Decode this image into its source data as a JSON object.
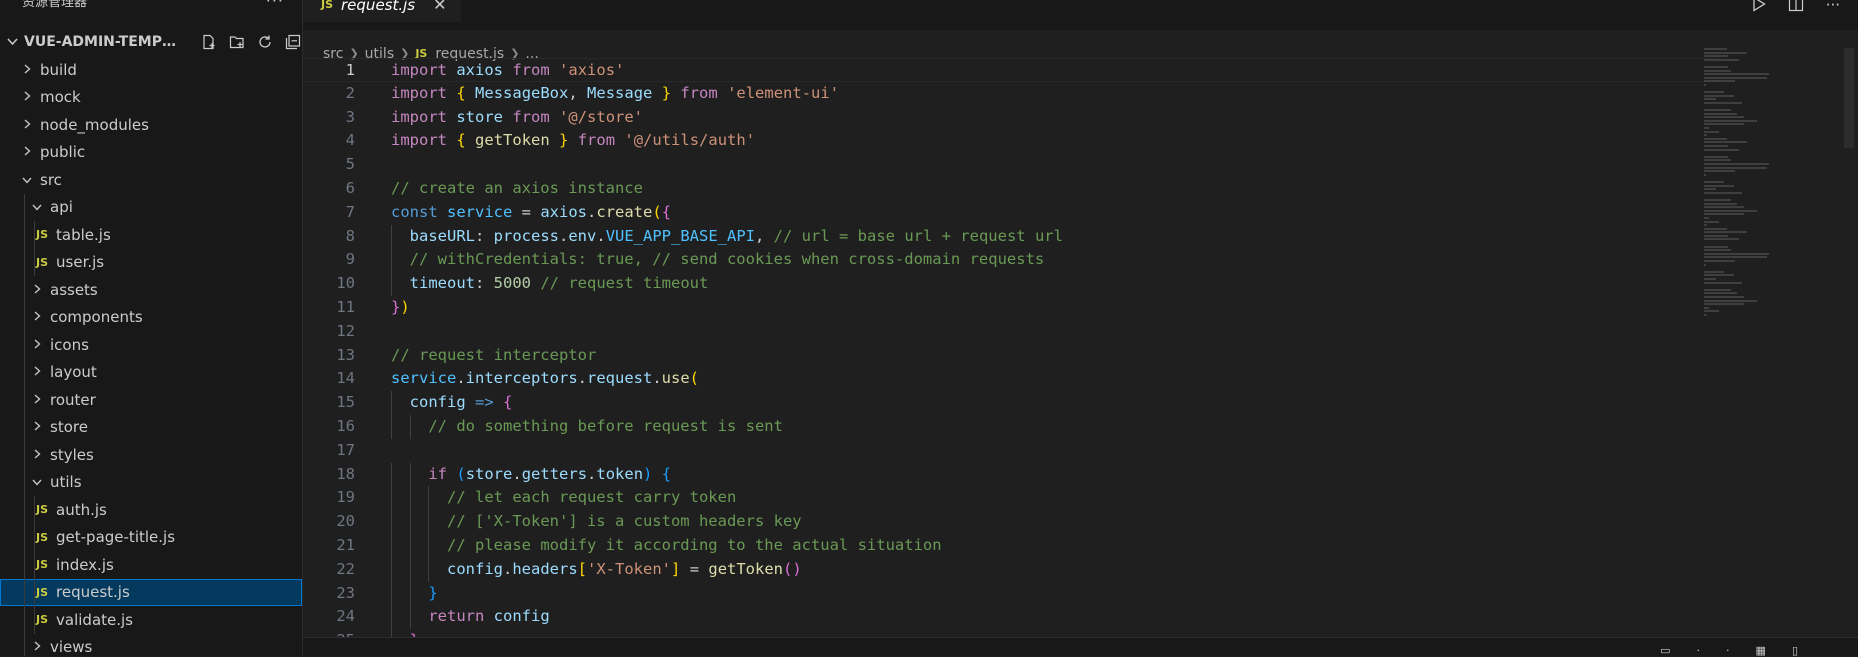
{
  "sidebar": {
    "header_title": "资源管理器",
    "more": "···",
    "project_title": "VUE-ADMIN-TEMPLAT...",
    "tree": [
      {
        "label": "build",
        "type": "folder",
        "depth": 0,
        "open": false
      },
      {
        "label": "mock",
        "type": "folder",
        "depth": 0,
        "open": false
      },
      {
        "label": "node_modules",
        "type": "folder",
        "depth": 0,
        "open": false
      },
      {
        "label": "public",
        "type": "folder",
        "depth": 0,
        "open": false
      },
      {
        "label": "src",
        "type": "folder",
        "depth": 0,
        "open": true
      },
      {
        "label": "api",
        "type": "folder",
        "depth": 1,
        "open": true
      },
      {
        "label": "table.js",
        "type": "file",
        "depth": 2
      },
      {
        "label": "user.js",
        "type": "file",
        "depth": 2
      },
      {
        "label": "assets",
        "type": "folder",
        "depth": 1,
        "open": false
      },
      {
        "label": "components",
        "type": "folder",
        "depth": 1,
        "open": false
      },
      {
        "label": "icons",
        "type": "folder",
        "depth": 1,
        "open": false
      },
      {
        "label": "layout",
        "type": "folder",
        "depth": 1,
        "open": false
      },
      {
        "label": "router",
        "type": "folder",
        "depth": 1,
        "open": false
      },
      {
        "label": "store",
        "type": "folder",
        "depth": 1,
        "open": false
      },
      {
        "label": "styles",
        "type": "folder",
        "depth": 1,
        "open": false
      },
      {
        "label": "utils",
        "type": "folder",
        "depth": 1,
        "open": true
      },
      {
        "label": "auth.js",
        "type": "file",
        "depth": 2
      },
      {
        "label": "get-page-title.js",
        "type": "file",
        "depth": 2
      },
      {
        "label": "index.js",
        "type": "file",
        "depth": 2
      },
      {
        "label": "request.js",
        "type": "file",
        "depth": 2,
        "selected": true
      },
      {
        "label": "validate.js",
        "type": "file",
        "depth": 2
      },
      {
        "label": "views",
        "type": "folder",
        "depth": 1,
        "open": false
      }
    ]
  },
  "editor": {
    "tab_label": "request.js",
    "file_badge": "JS",
    "breadcrumb": [
      "src",
      "utils",
      "request.js",
      "..."
    ],
    "active_line": 1,
    "lines": [
      [
        [
          "kw",
          "import"
        ],
        [
          "pl",
          " "
        ],
        [
          "var",
          "axios"
        ],
        [
          "pl",
          " "
        ],
        [
          "kw",
          "from"
        ],
        [
          "pl",
          " "
        ],
        [
          "str",
          "'axios'"
        ]
      ],
      [
        [
          "kw",
          "import"
        ],
        [
          "pl",
          " "
        ],
        [
          "b1",
          "{"
        ],
        [
          "pl",
          " "
        ],
        [
          "var",
          "MessageBox"
        ],
        [
          "pl",
          ", "
        ],
        [
          "var",
          "Message"
        ],
        [
          "pl",
          " "
        ],
        [
          "b1",
          "}"
        ],
        [
          "pl",
          " "
        ],
        [
          "kw",
          "from"
        ],
        [
          "pl",
          " "
        ],
        [
          "str",
          "'element-ui'"
        ]
      ],
      [
        [
          "kw",
          "import"
        ],
        [
          "pl",
          " "
        ],
        [
          "var",
          "store"
        ],
        [
          "pl",
          " "
        ],
        [
          "kw",
          "from"
        ],
        [
          "pl",
          " "
        ],
        [
          "str",
          "'@/store'"
        ]
      ],
      [
        [
          "kw",
          "import"
        ],
        [
          "pl",
          " "
        ],
        [
          "b1",
          "{"
        ],
        [
          "pl",
          " "
        ],
        [
          "fn",
          "getToken"
        ],
        [
          "pl",
          " "
        ],
        [
          "b1",
          "}"
        ],
        [
          "pl",
          " "
        ],
        [
          "kw",
          "from"
        ],
        [
          "pl",
          " "
        ],
        [
          "str",
          "'@/utils/auth'"
        ]
      ],
      [],
      [
        [
          "cm",
          "// create an axios instance"
        ]
      ],
      [
        [
          "dec",
          "const"
        ],
        [
          "pl",
          " "
        ],
        [
          "cst",
          "service"
        ],
        [
          "pl",
          " = "
        ],
        [
          "var",
          "axios"
        ],
        [
          "pl",
          "."
        ],
        [
          "fn",
          "create"
        ],
        [
          "b1",
          "("
        ],
        [
          "b2",
          "{"
        ]
      ],
      [
        [
          "pl",
          "  "
        ],
        [
          "var",
          "baseURL"
        ],
        [
          "pl",
          ": "
        ],
        [
          "var",
          "process"
        ],
        [
          "pl",
          "."
        ],
        [
          "var",
          "env"
        ],
        [
          "pl",
          "."
        ],
        [
          "cst",
          "VUE_APP_BASE_API"
        ],
        [
          "pl",
          ", "
        ],
        [
          "cm",
          "// url = base url + request url"
        ]
      ],
      [
        [
          "pl",
          "  "
        ],
        [
          "cm",
          "// withCredentials: true, // send cookies when cross-domain requests"
        ]
      ],
      [
        [
          "pl",
          "  "
        ],
        [
          "var",
          "timeout"
        ],
        [
          "pl",
          ": "
        ],
        [
          "num",
          "5000"
        ],
        [
          "pl",
          " "
        ],
        [
          "cm",
          "// request timeout"
        ]
      ],
      [
        [
          "b2",
          "}"
        ],
        [
          "b1",
          ")"
        ]
      ],
      [],
      [
        [
          "cm",
          "// request interceptor"
        ]
      ],
      [
        [
          "cst",
          "service"
        ],
        [
          "pl",
          "."
        ],
        [
          "var",
          "interceptors"
        ],
        [
          "pl",
          "."
        ],
        [
          "var",
          "request"
        ],
        [
          "pl",
          "."
        ],
        [
          "fn",
          "use"
        ],
        [
          "b1",
          "("
        ]
      ],
      [
        [
          "pl",
          "  "
        ],
        [
          "var",
          "config"
        ],
        [
          "pl",
          " "
        ],
        [
          "dec",
          "=>"
        ],
        [
          "pl",
          " "
        ],
        [
          "b2",
          "{"
        ]
      ],
      [
        [
          "pl",
          "    "
        ],
        [
          "cm",
          "// do something before request is sent"
        ]
      ],
      [],
      [
        [
          "pl",
          "    "
        ],
        [
          "kw",
          "if"
        ],
        [
          "pl",
          " "
        ],
        [
          "b3",
          "("
        ],
        [
          "var",
          "store"
        ],
        [
          "pl",
          "."
        ],
        [
          "var",
          "getters"
        ],
        [
          "pl",
          "."
        ],
        [
          "var",
          "token"
        ],
        [
          "b3",
          ")"
        ],
        [
          "pl",
          " "
        ],
        [
          "b3",
          "{"
        ]
      ],
      [
        [
          "pl",
          "      "
        ],
        [
          "cm",
          "// let each request carry token"
        ]
      ],
      [
        [
          "pl",
          "      "
        ],
        [
          "cm",
          "// ['X-Token'] is a custom headers key"
        ]
      ],
      [
        [
          "pl",
          "      "
        ],
        [
          "cm",
          "// please modify it according to the actual situation"
        ]
      ],
      [
        [
          "pl",
          "      "
        ],
        [
          "var",
          "config"
        ],
        [
          "pl",
          "."
        ],
        [
          "var",
          "headers"
        ],
        [
          "b1",
          "["
        ],
        [
          "str",
          "'X-Token'"
        ],
        [
          "b1",
          "]"
        ],
        [
          "pl",
          " = "
        ],
        [
          "fn",
          "getToken"
        ],
        [
          "b2",
          "()"
        ]
      ],
      [
        [
          "pl",
          "    "
        ],
        [
          "b3",
          "}"
        ]
      ],
      [
        [
          "pl",
          "    "
        ],
        [
          "kw",
          "return"
        ],
        [
          "pl",
          " "
        ],
        [
          "var",
          "config"
        ]
      ],
      [
        [
          "pl",
          "  "
        ],
        [
          "b2",
          "}"
        ]
      ]
    ]
  },
  "colors": {
    "accent": "#0078d4",
    "selection": "#04395e",
    "js_badge": "#cbcb41",
    "keyword": "#c586c0",
    "string": "#ce9178",
    "comment": "#6a9955"
  }
}
